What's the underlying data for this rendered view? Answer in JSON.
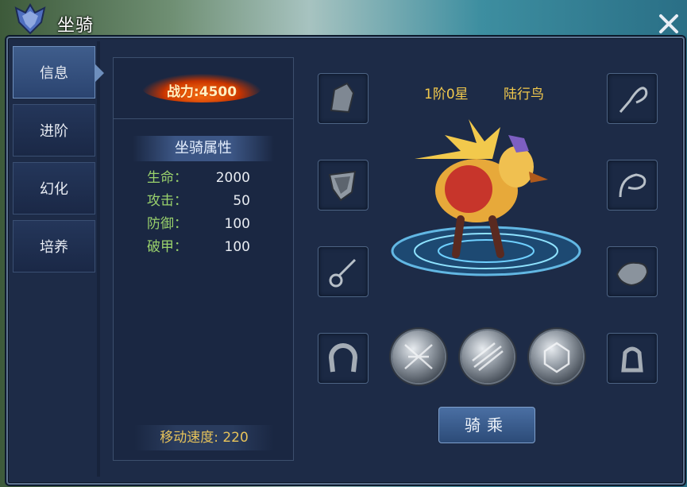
{
  "window": {
    "title": "坐骑"
  },
  "tabs": [
    {
      "label": "信息",
      "active": true
    },
    {
      "label": "进阶",
      "active": false
    },
    {
      "label": "幻化",
      "active": false
    },
    {
      "label": "培养",
      "active": false
    }
  ],
  "power": {
    "text": "战力:4500"
  },
  "attributes": {
    "title": "坐骑属性",
    "rows": [
      {
        "label": "生命：",
        "value": "2000"
      },
      {
        "label": "攻击：",
        "value": "50"
      },
      {
        "label": "防御：",
        "value": "100"
      },
      {
        "label": "破甲：",
        "value": "100"
      }
    ]
  },
  "speed": {
    "text": "移动速度: 220"
  },
  "mount": {
    "level": "1阶0星",
    "name": "陆行鸟"
  },
  "equipment_slots": {
    "left": [
      "helmet-icon",
      "armor-icon",
      "rope-icon",
      "horseshoe-icon"
    ],
    "right": [
      "whip-icon",
      "rein-icon",
      "saddle-icon",
      "stirrup-icon"
    ]
  },
  "skill_orbs": [
    "skill-orb-1",
    "skill-orb-2",
    "skill-orb-3"
  ],
  "ride_button": {
    "label": "骑乘"
  },
  "colors": {
    "accent_gold": "#f2c94c",
    "attr_green": "#9ad26c",
    "panel_bg": "#1d2b47"
  }
}
